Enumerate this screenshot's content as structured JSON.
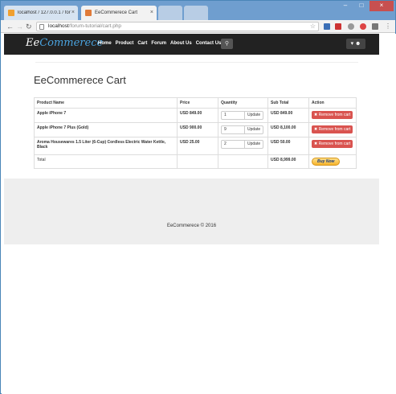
{
  "browser": {
    "tabs": [
      {
        "title": "localhost / 127.0.0.1 / for"
      },
      {
        "title": "EeCommerece Cart"
      }
    ],
    "address": {
      "host": "localhost",
      "path": "/forum-tutorial/cart.php"
    }
  },
  "navbar": {
    "brand_prefix": "Ee",
    "brand_suffix": "Commerece",
    "links": [
      "Home",
      "Product",
      "Cart",
      "Forum",
      "About Us",
      "Contact Us"
    ]
  },
  "page": {
    "title": "EeCommerece Cart"
  },
  "table": {
    "headers": [
      "Product Name",
      "Price",
      "Quantity",
      "Sub Total",
      "Action"
    ],
    "rows": [
      {
        "name": "Apple iPhone 7",
        "price": "USD 849.00",
        "qty": "1",
        "subtotal": "USD 849.00"
      },
      {
        "name": "Apple iPhone 7 Plus (Gold)",
        "price": "USD 900.00",
        "qty": "9",
        "subtotal": "USD 8,100.00"
      },
      {
        "name": "Aroma Housewares 1.5 Liter (6-Cup) Cordless Electric Water Kettle, Black",
        "price": "USD 25.00",
        "qty": "2",
        "subtotal": "USD 50.00"
      }
    ],
    "update_label": "Update",
    "remove_label": "Remove from cart",
    "total_label": "Total",
    "total_value": "USD 8,999.00",
    "buy_label": "Buy Now"
  },
  "footer": {
    "text": "EeCommerece © 2016"
  },
  "colors": {
    "navbar": "#222222",
    "remove": "#d9534f",
    "brand_accent": "#4aa3df"
  }
}
